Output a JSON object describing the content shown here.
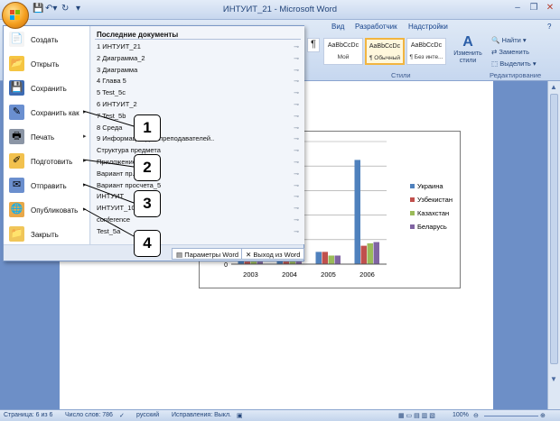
{
  "window": {
    "title": "ИНТУИТ_21 - Microsoft Word"
  },
  "ribbon": {
    "tabs": [
      "Вид",
      "Разработчик",
      "Надстройки"
    ],
    "styles": [
      {
        "sample": "AaBbCcDc",
        "name": "Мой"
      },
      {
        "sample": "AaBbCcDc",
        "name": "¶ Обычный"
      },
      {
        "sample": "AaBbCcDc",
        "name": "¶ Без инте..."
      }
    ],
    "change_styles": "Изменить стили",
    "styles_group": "Стили",
    "editing": {
      "find": "Найти",
      "replace": "Заменить",
      "select": "Выделить",
      "group": "Редактирование"
    }
  },
  "menu": {
    "items": [
      {
        "label": "Создать",
        "icon": "new-document-icon",
        "arrow": false
      },
      {
        "label": "Открыть",
        "icon": "open-folder-icon",
        "arrow": false
      },
      {
        "label": "Сохранить",
        "icon": "save-icon",
        "arrow": false
      },
      {
        "label": "Сохранить как",
        "icon": "save-as-icon",
        "arrow": true
      },
      {
        "label": "Печать",
        "icon": "print-icon",
        "arrow": true
      },
      {
        "label": "Подготовить",
        "icon": "prepare-icon",
        "arrow": true
      },
      {
        "label": "Отправить",
        "icon": "send-icon",
        "arrow": true
      },
      {
        "label": "Опубликовать",
        "icon": "publish-icon",
        "arrow": true
      },
      {
        "label": "Закрыть",
        "icon": "close-folder-icon",
        "arrow": false
      }
    ],
    "recent_title": "Последние документы",
    "recent": [
      "1  ИНТУИТ_21",
      "2  Диаграмма_2",
      "3  Диаграмма",
      "4  Глава 5",
      "5  Test_5c",
      "6  ИНТУИТ_2",
      "7  Test_5b",
      "8  Среда",
      "9  Информация для преподавателей..",
      "   Структура предмета",
      "   Приложение",
      "   Вариант пр. 3",
      "   Вариант просчета_5",
      "   ИНТУИТ",
      "   ИНТУИТ_10",
      "   conference",
      "   Test_5a"
    ],
    "options_btn": "Параметры Word",
    "exit_btn": "Выход из Word"
  },
  "callouts": [
    "1",
    "2",
    "3",
    "4"
  ],
  "status": {
    "page": "Страница: 6 из 6",
    "words": "Число слов: 786",
    "lang": "русский",
    "fixes": "Исправления: Выкл.",
    "zoom": "100%"
  },
  "chart_data": {
    "type": "bar",
    "categories": [
      "2003",
      "2004",
      "2005",
      "2006"
    ],
    "ylim": [
      0,
      100
    ],
    "series": [
      {
        "name": "Украина",
        "color": "#4f81bd",
        "values": [
          3,
          3,
          10,
          85
        ]
      },
      {
        "name": "Узбекистан",
        "color": "#c0504d",
        "values": [
          2,
          2,
          10,
          15
        ]
      },
      {
        "name": "Казахстан",
        "color": "#9bbb59",
        "values": [
          2,
          2,
          7,
          17
        ]
      },
      {
        "name": "Беларусь",
        "color": "#8064a2",
        "values": [
          2,
          2,
          7,
          18
        ]
      }
    ],
    "ytick_visible": "0"
  }
}
